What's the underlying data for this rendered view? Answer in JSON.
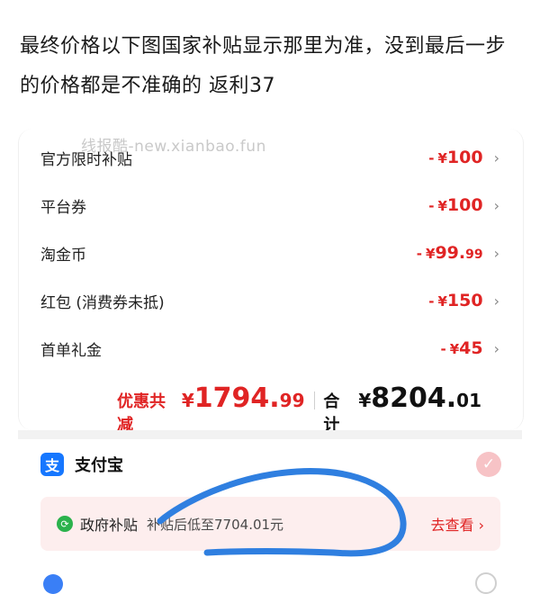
{
  "note_text": "最终价格以下图国家补贴显示那里为准，没到最后一步的价格都是不准确的 返利37",
  "watermark": "线报酷-new.xianbao.fun",
  "discounts": [
    {
      "label": "官方限时补贴",
      "minus": "-",
      "yen": "¥",
      "int": "100",
      "dec": ""
    },
    {
      "label": "平台券",
      "minus": "-",
      "yen": "¥",
      "int": "100",
      "dec": ""
    },
    {
      "label": "淘金币",
      "minus": "-",
      "yen": "¥",
      "int": "99.",
      "dec": "99"
    },
    {
      "label": "红包 (消费券未抵)",
      "minus": "-",
      "yen": "¥",
      "int": "150",
      "dec": ""
    },
    {
      "label": "首单礼金",
      "minus": "-",
      "yen": "¥",
      "int": "45",
      "dec": ""
    }
  ],
  "chevron": "›",
  "summary": {
    "discount_label": "优惠共减",
    "discount_yen": "¥",
    "discount_int": "1794.",
    "discount_dec": "99",
    "total_label": "合计",
    "total_yen": "¥",
    "total_int": "8204.",
    "total_dec": "01"
  },
  "payment": {
    "icon_glyph": "支",
    "name": "支付宝",
    "check_glyph": "✓",
    "selected": true
  },
  "subsidy": {
    "icon_glyph": "⟳",
    "label": "政府补贴",
    "desc": "补贴后低至7704.01元",
    "action": "去查看 ›"
  },
  "colors": {
    "accent_red": "#e02424",
    "alipay_blue": "#1677ff",
    "subsidy_bg": "#fdeeee",
    "scribble_blue": "#2f7fe0"
  }
}
